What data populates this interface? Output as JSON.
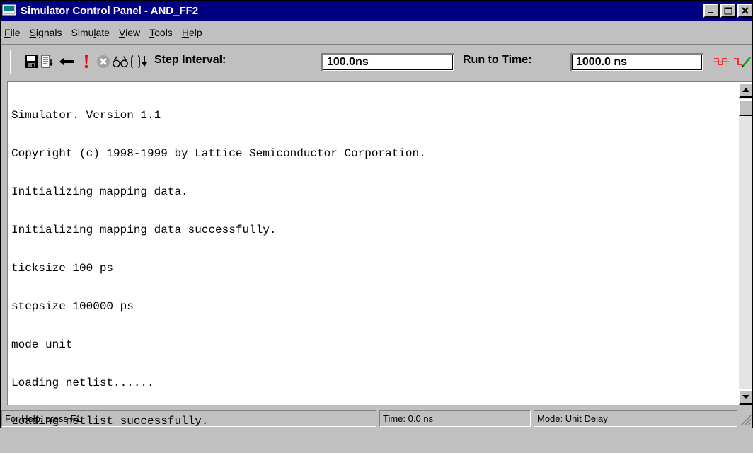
{
  "window": {
    "title": "Simulator Control Panel - AND_FF2",
    "min_label": "_",
    "max_label": "□",
    "close_label": "✕"
  },
  "menu": [
    {
      "pre": "",
      "u": "F",
      "post": "ile"
    },
    {
      "pre": "",
      "u": "S",
      "post": "ignals"
    },
    {
      "pre": "Simu",
      "u": "l",
      "post": "ate"
    },
    {
      "pre": "",
      "u": "V",
      "post": "iew"
    },
    {
      "pre": "",
      "u": "T",
      "post": "ools"
    },
    {
      "pre": "",
      "u": "H",
      "post": "elp"
    }
  ],
  "toolbar": {
    "step_interval_label": "Step Interval:",
    "step_interval_value": "100.0ns",
    "run_to_time_label": "Run to Time:",
    "run_to_time_value": "1000.0 ns",
    "icons": [
      "save-icon",
      "list-icon",
      "back-arrow-icon",
      "exclamation-icon",
      "stop-icon",
      "glasses-icon",
      "step-into-icon",
      "waveform-icon",
      "waveform-edit-icon"
    ]
  },
  "console": {
    "lines": [
      "Simulator. Version 1.1",
      "Copyright (c) 1998-1999 by Lattice Semiconductor Corporation.",
      "Initializing mapping data.",
      "Initializing mapping data successfully.",
      "ticksize 100 ps",
      "stepsize 100000 ps",
      "mode unit",
      "Loading netlist......",
      "Loading netlist successfully."
    ]
  },
  "status": {
    "help": "For Help, press F1",
    "time": "Time: 0.0 ns",
    "mode": "Mode: Unit Delay"
  },
  "colors": {
    "title_bar": "#000080",
    "window_face": "#c0c0c0",
    "console_bg": "#ffffff",
    "exclamation": "#ff0000",
    "waveform_red": "#ff0000",
    "waveform_green": "#00a000"
  }
}
